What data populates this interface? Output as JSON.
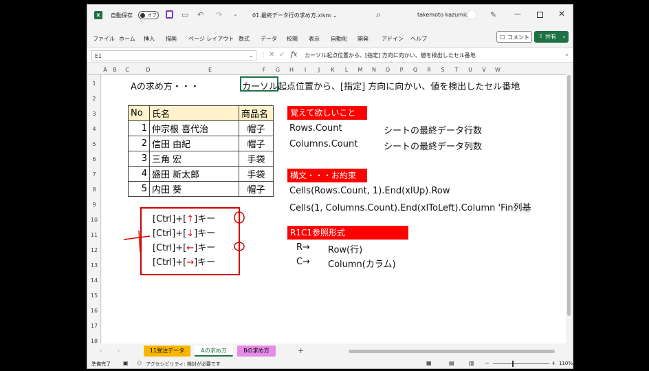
{
  "titlebar": {
    "autosave_label": "自動保存",
    "autosave_state": "オフ",
    "filename": "01.最終データ行の求め方.xlsm ⌄",
    "user": "takemoto kazumichi"
  },
  "menu": {
    "items": [
      "ファイル",
      "ホーム",
      "挿入",
      "描画",
      "ページ レイアウト",
      "数式",
      "データ",
      "校閲",
      "表示",
      "自動化",
      "開発",
      "アドイン",
      "ヘルプ"
    ],
    "comment_label": "コメント",
    "share_label": "共有"
  },
  "formula_bar": {
    "cell_ref": "E1",
    "fx": "fx",
    "content": "カーソル起点位置から、[指定] 方向に向かい、値を検出したセル番地"
  },
  "columns": [
    "A",
    "B",
    "C",
    "D",
    "E",
    "F",
    "G",
    "H",
    "I",
    "J",
    "K",
    "L",
    "M",
    "N",
    "O",
    "P",
    "Q",
    "R",
    "S",
    "T",
    "U",
    "V",
    "W"
  ],
  "rows": [
    "1",
    "2",
    "3",
    "4",
    "5",
    "6",
    "7",
    "8",
    "9",
    "10",
    "11",
    "12",
    "13",
    "14",
    "15",
    "16",
    "17",
    "18"
  ],
  "sheet": {
    "title": "Aの求め方・・・",
    "e1": "カーソル起点位置から、[指定] 方向に向かい、値を検出したセル番地",
    "table": {
      "headers": [
        "No",
        "氏名",
        "商品名"
      ],
      "rows": [
        [
          "1",
          "仲宗根 喜代治",
          "帽子"
        ],
        [
          "2",
          "信田 由紀",
          "帽子"
        ],
        [
          "3",
          "三角 宏",
          "手袋"
        ],
        [
          "4",
          "盛田 新太郎",
          "手袋"
        ],
        [
          "5",
          "内田 葵",
          "帽子"
        ]
      ]
    },
    "keys": [
      {
        "pre": "[Ctrl]+[",
        "arrow": "↑",
        "post": "]キー"
      },
      {
        "pre": "[Ctrl]+[",
        "arrow": "↓",
        "post": "]キー"
      },
      {
        "pre": "[Ctrl]+[",
        "arrow": "←",
        "post": "]キー"
      },
      {
        "pre": "[Ctrl]+[",
        "arrow": "→",
        "post": "]キー"
      }
    ],
    "sec1_label": "覚えて欲しいこと",
    "rows_count": "Rows.Count",
    "rows_count_desc": "シートの最終データ行数",
    "cols_count": "Columns.Count",
    "cols_count_desc": "シートの最終データ列数",
    "sec2_label": "構文・・・お約束",
    "syntax1": "Cells(Rows.Count, 1).End(xlUp).Row",
    "syntax2": "Cells(1, Columns.Count).End(xlToLeft).Column 'Fin列基",
    "sec3_label": "R1C1参照形式",
    "r_label": "R→",
    "r_desc": "Row(行)",
    "c_label": "C→",
    "c_desc": "Column(カラム)"
  },
  "tabs": {
    "items": [
      "11受注データ",
      "Aの求め方",
      "Bの求め方"
    ],
    "add": "+",
    "colors": {
      "tab1": "#f7b500",
      "tab3": "#e58be8"
    }
  },
  "status": {
    "ready": "準備完了",
    "accessibility": "アクセシビリティ: 検討が必要です",
    "zoom": "110%"
  }
}
